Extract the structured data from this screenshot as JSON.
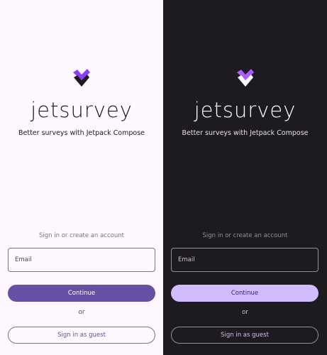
{
  "app": {
    "wordmark": "jetsurvey",
    "tagline": "Better surveys with Jetpack Compose"
  },
  "signin": {
    "prompt": "Sign in or create an account",
    "email_label": "Email",
    "continue_label": "Continue",
    "or_label": "or",
    "guest_label": "Sign in as guest"
  },
  "themes": {
    "light": {
      "background": "#FEF7FF",
      "primary": "#6750A4",
      "on_primary": "#FFFFFF",
      "text": "#1D1B20"
    },
    "dark": {
      "background": "#1D1B20",
      "primary": "#D0BCFF",
      "on_primary": "#381E72",
      "text": "#FFFFFF"
    }
  },
  "icons": {
    "logo": "jetsurvey-checkmark-logo-icon"
  }
}
